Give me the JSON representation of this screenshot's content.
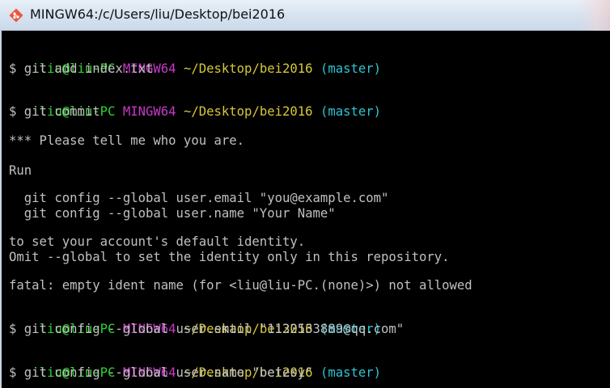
{
  "window": {
    "title": "MINGW64:/c/Users/liu/Desktop/bei2016",
    "icon": "git-bash-icon"
  },
  "colors": {
    "background": "#000000",
    "text": "#c0c0c0",
    "user_host": "#2fd22f",
    "env": "#c838c8",
    "path": "#d7c73a",
    "branch": "#2ec4d6"
  },
  "prompts": [
    {
      "user": "liu@liu-PC",
      "env": "MINGW64",
      "path": "~/Desktop/bei2016",
      "branch": "(master)",
      "command": "$ git add index.txt"
    },
    {
      "user": "liu@liu-PC",
      "env": "MINGW64",
      "path": "~/Desktop/bei2016",
      "branch": "(master)",
      "command": "$ git commit"
    },
    {
      "user": "liu@liu-PC",
      "env": "MINGW64",
      "path": "~/Desktop/bei2016",
      "branch": "(master)",
      "command": "$ git config --global user.email \"1132533889@qq.com\""
    },
    {
      "user": "liu@liu-PC",
      "env": "MINGW64",
      "path": "~/Desktop/bei2016",
      "branch": "(master)",
      "command": "$ git config --global user.name \"betesy\""
    }
  ],
  "output": {
    "l1": "*** Please tell me who you are.",
    "l2": "Run",
    "l3": "  git config --global user.email \"you@example.com\"",
    "l4": "  git config --global user.name \"Your Name\"",
    "l5": "to set your account's default identity.",
    "l6": "Omit --global to set the identity only in this repository.",
    "l7": "fatal: empty ident name (for <liu@liu-PC.(none)>) not allowed"
  }
}
